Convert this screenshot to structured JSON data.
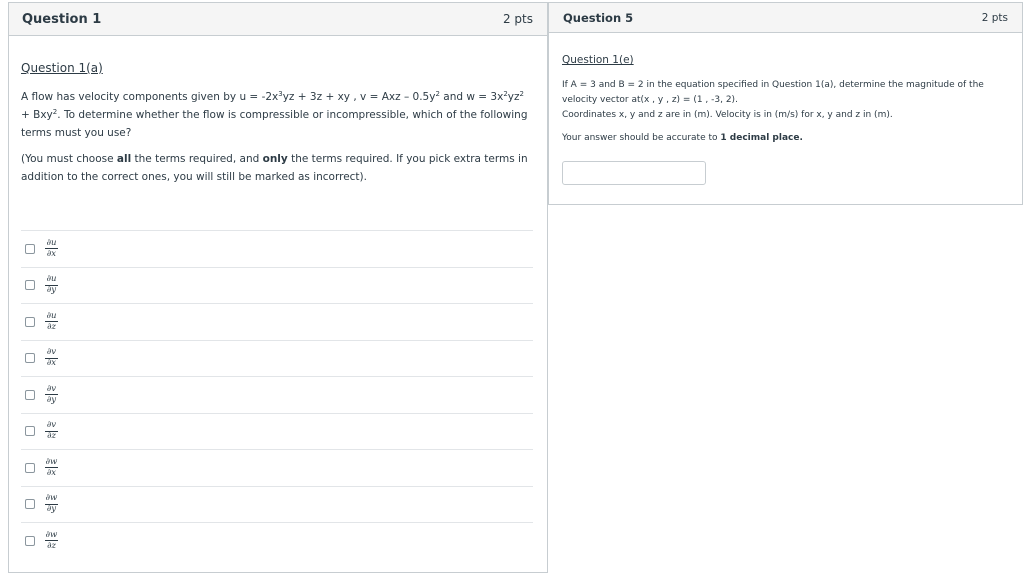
{
  "question1": {
    "title": "Question 1",
    "points": "2 pts",
    "subheading": "Question 1(a)",
    "body": {
      "intro": "A flow has velocity components given by",
      "u_label": "u = -2x",
      "u_exp1": "3",
      "u_mid": "yz + 3z + xy , v = Axz – 0.5y",
      "v_exp": "2",
      "w_label": " and w = 3x",
      "w_exp1": "2",
      "w_mid1": "yz",
      "w_exp2": "2",
      "w_mid2": " + Bxy",
      "w_exp3": "2",
      "end": ".",
      "question": "To determine whether the flow is compressible or incompressible, which of the following terms must you use?"
    },
    "instruction": {
      "pre1": "(You must choose ",
      "bold1": "all",
      "mid1": " the terms required, and ",
      "bold2": "only",
      "post": " the terms required. If you pick extra terms in addition to the correct ones, you will still be marked as incorrect)."
    },
    "options": [
      {
        "num": "∂u",
        "den": "∂x"
      },
      {
        "num": "∂u",
        "den": "∂y"
      },
      {
        "num": "∂u",
        "den": "∂z"
      },
      {
        "num": "∂v",
        "den": "∂x"
      },
      {
        "num": "∂v",
        "den": "∂y"
      },
      {
        "num": "∂v",
        "den": "∂z"
      },
      {
        "num": "∂w",
        "den": "∂x"
      },
      {
        "num": "∂w",
        "den": "∂y"
      },
      {
        "num": "∂w",
        "den": "∂z"
      }
    ]
  },
  "question5": {
    "title": "Question 5",
    "points": "2 pts",
    "subheading": "Question 1(e)",
    "line1": "If A = 3 and B = 2 in the equation specified in Question 1(a), determine the magnitude of the velocity vector at(x , y , z) = (1 , -3, 2).",
    "line2": "Coordinates x, y and z are in (m). Velocity is in (m/s) for x, y and z in (m).",
    "line3_pre": "Your answer should be accurate to ",
    "line3_bold": "1 decimal place.",
    "answer_value": ""
  }
}
